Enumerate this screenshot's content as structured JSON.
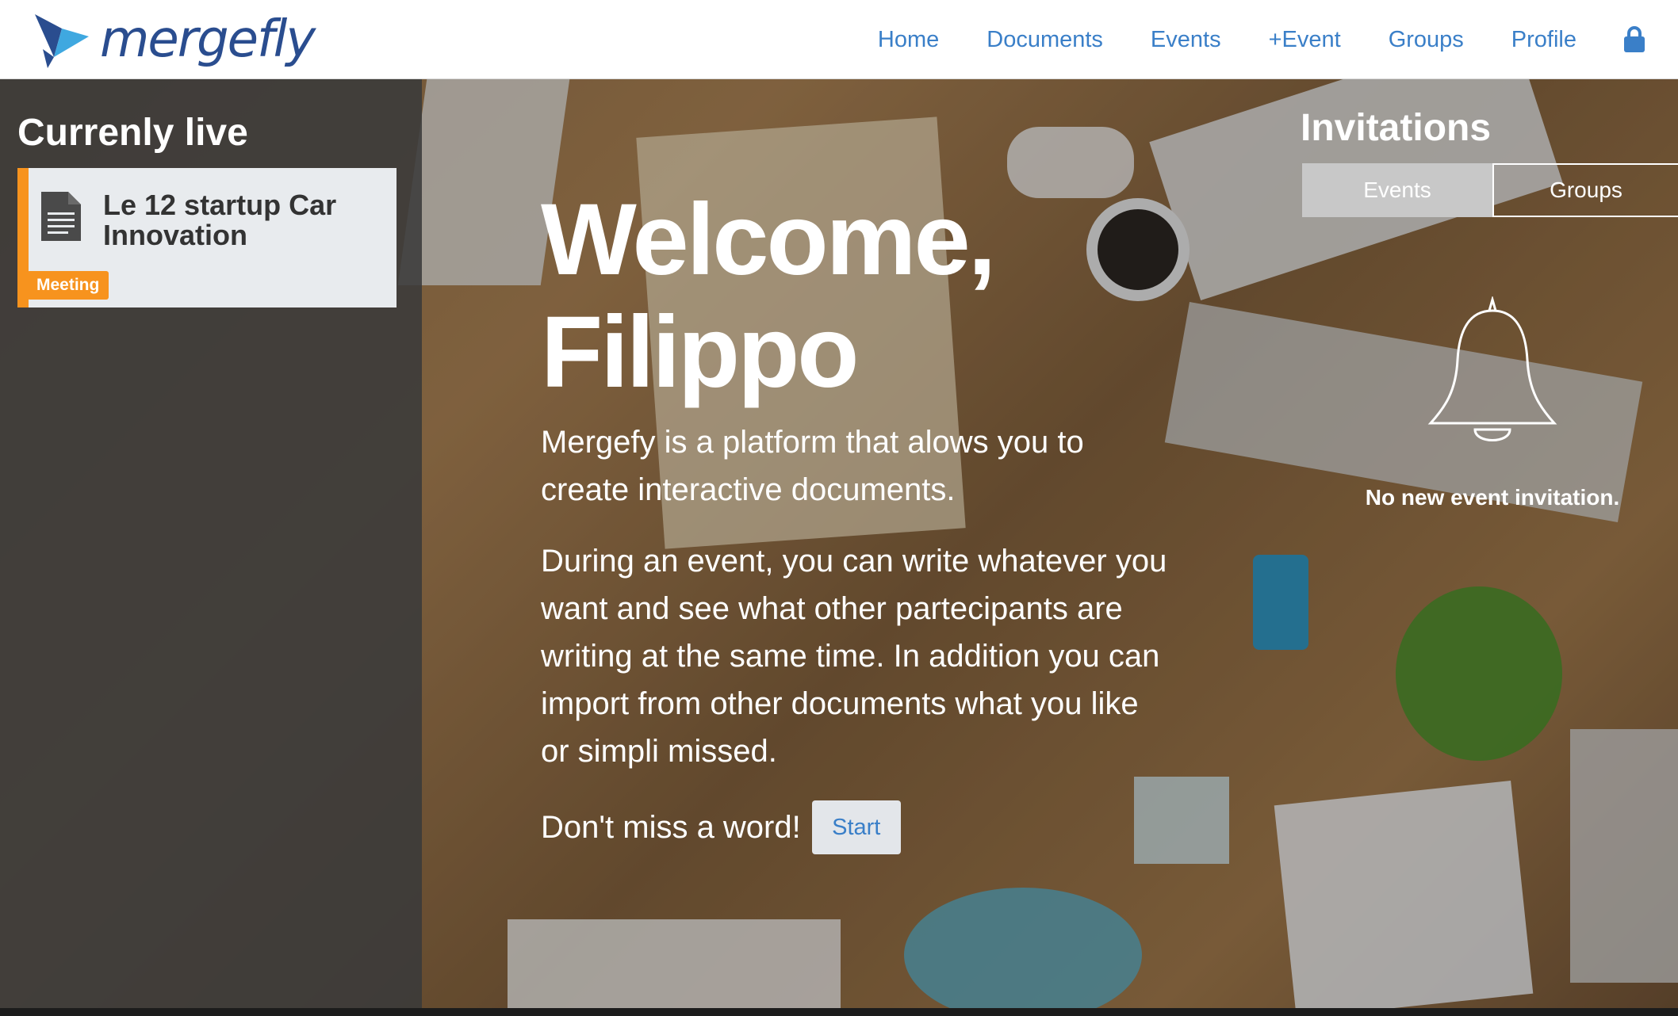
{
  "brand": {
    "name": "mergefly",
    "color": "#2a4d8f",
    "accent": "#3fa8e0"
  },
  "nav": {
    "items": [
      {
        "label": "Home"
      },
      {
        "label": "Documents"
      },
      {
        "label": "Events"
      },
      {
        "label": "+Event"
      },
      {
        "label": "Groups"
      },
      {
        "label": "Profile"
      }
    ],
    "lock_icon": "lock-icon",
    "link_color": "#3a7fc8"
  },
  "sidebar": {
    "title": "Currenly live",
    "cards": [
      {
        "title": "Le 12 startup Car Innovation",
        "badge": "Meeting",
        "icon": "document-icon",
        "badge_color": "#f7931e"
      }
    ]
  },
  "main": {
    "greeting_line1": "Welcome,",
    "greeting_line2": "Filippo",
    "intro": "Mergefy is a platform that alows you to create interactive documents.",
    "description": "During an event, you can write whatever you want and see what other partecipants are writing at the same time. In addition you can import from other documents what you like or simpli missed.",
    "cta_text": "Don't miss a word!",
    "start_label": "Start"
  },
  "invitations": {
    "title": "Invitations",
    "tabs": [
      {
        "label": "Events",
        "active": true
      },
      {
        "label": "Groups",
        "active": false
      }
    ],
    "empty_icon": "bell-icon",
    "empty_message": "No new event invitation."
  }
}
